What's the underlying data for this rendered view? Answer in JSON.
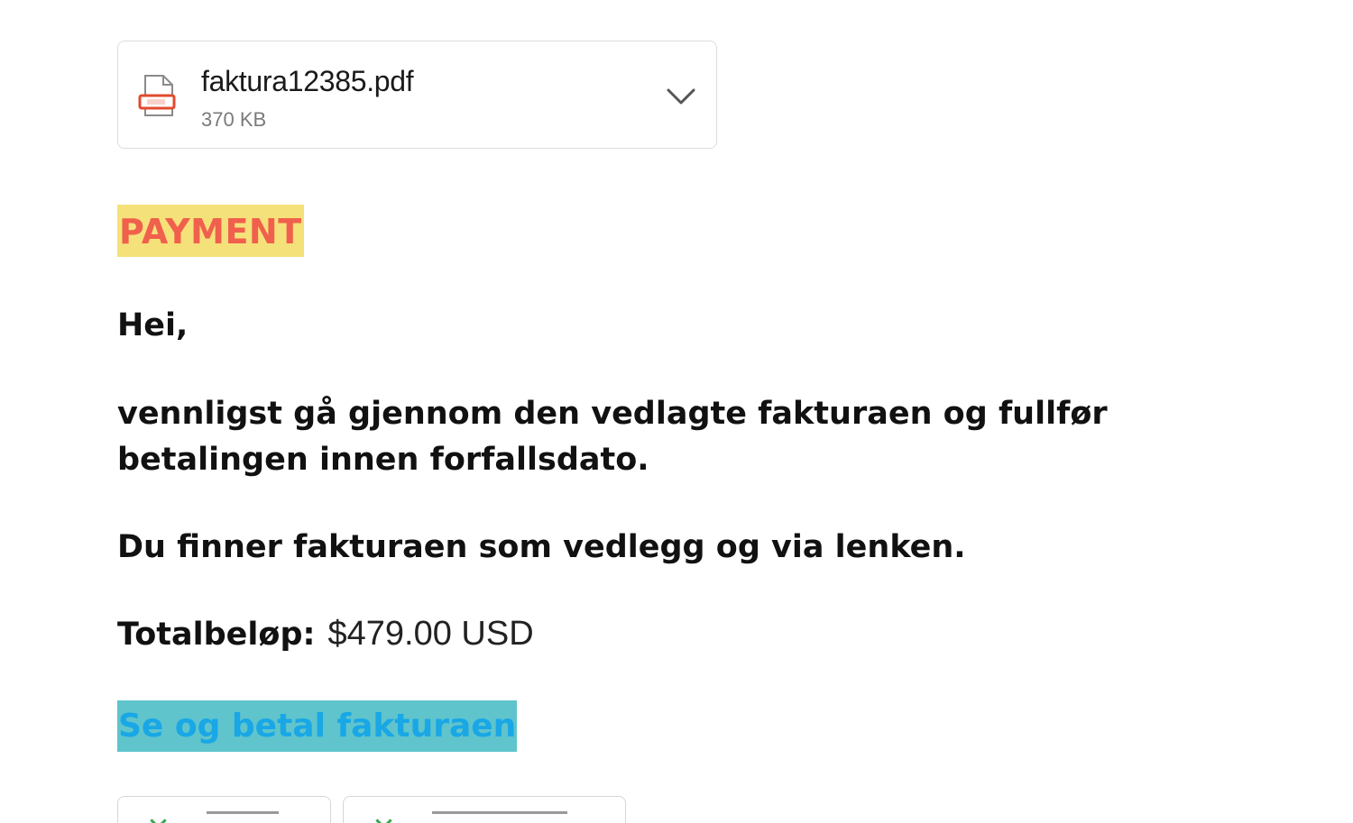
{
  "attachment": {
    "file_name": "faktura12385.pdf",
    "file_size": "370 KB",
    "file_icon": "pdf-file-icon",
    "expand_icon": "chevron-down-icon"
  },
  "email": {
    "badge": "PAYMENT",
    "greeting": "Hei,",
    "paragraph1": "vennligst gå gjennom den vedlagte fakturaen og fullfør betalingen innen forfallsdato.",
    "paragraph2": "Du finner fakturaen som vedlegg og via lenken.",
    "total_label": "Totalbeløp:",
    "total_value": "$479.00 USD",
    "link_label": "Se og betal fakturaen"
  },
  "colors": {
    "badge_background": "#f5e17a",
    "badge_text": "#f0604d",
    "link_background": "#5fc4cc",
    "link_text": "#19a7e6"
  }
}
